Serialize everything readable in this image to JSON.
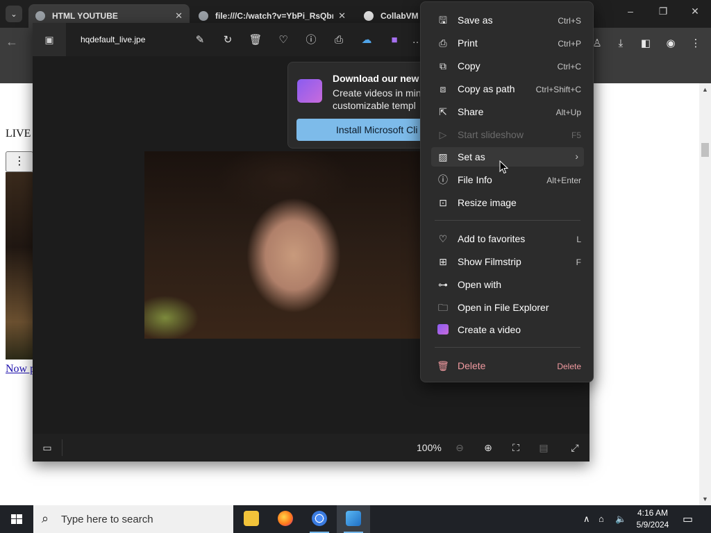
{
  "browser": {
    "tabs": [
      {
        "title": "HTML YOUTUBE",
        "active": true
      },
      {
        "title": "file:///C:/watch?v=YbPi_RsQbr",
        "active": false
      },
      {
        "title": "CollabVM",
        "active": false
      }
    ],
    "tab_close": "✕",
    "tab_list_icon": "⌄",
    "window_controls": [
      "–",
      "❐",
      "✕"
    ]
  },
  "webpage": {
    "live_text": "LIVE",
    "menu_glyph": "⋮",
    "link_text": "Now p"
  },
  "photos": {
    "filename": "hqdefault_live.jpe",
    "toolbar_icons": [
      "edit-image-icon",
      "rotate-icon",
      "delete-icon",
      "favorite-icon",
      "info-icon",
      "print-icon",
      "onedrive-icon",
      "clipchamp-icon",
      "more-icon"
    ],
    "promo": {
      "title": "Download our new v",
      "text": "Create videos in min customizable templ",
      "button": "Install Microsoft Cli"
    },
    "footer": {
      "zoom": "100%"
    }
  },
  "context_menu": {
    "items": [
      {
        "label": "Save as",
        "accel": "Ctrl+S",
        "icon": "save-as-icon"
      },
      {
        "label": "Print",
        "accel": "Ctrl+P",
        "icon": "print-icon"
      },
      {
        "label": "Copy",
        "accel": "Ctrl+C",
        "icon": "copy-icon"
      },
      {
        "label": "Copy as path",
        "accel": "Ctrl+Shift+C",
        "icon": "copy-path-icon"
      },
      {
        "label": "Share",
        "accel": "Alt+Up",
        "icon": "share-icon"
      },
      {
        "label": "Start slideshow",
        "accel": "F5",
        "icon": "slideshow-icon",
        "disabled": true
      },
      {
        "label": "Set as",
        "accel": "",
        "icon": "set-as-icon",
        "submenu": true
      },
      {
        "label": "File Info",
        "accel": "Alt+Enter",
        "icon": "info-icon"
      },
      {
        "label": "Resize image",
        "accel": "",
        "icon": "resize-icon"
      },
      {
        "label": "Add to favorites",
        "accel": "L",
        "icon": "heart-icon"
      },
      {
        "label": "Show Filmstrip",
        "accel": "F",
        "icon": "filmstrip-icon"
      },
      {
        "label": "Open with",
        "accel": "",
        "icon": "open-with-icon"
      },
      {
        "label": "Open in File Explorer",
        "accel": "",
        "icon": "folder-icon"
      },
      {
        "label": "Create a video",
        "accel": "",
        "icon": "clipchamp-icon"
      },
      {
        "label": "Delete",
        "accel": "Delete",
        "icon": "trash-icon",
        "danger": true
      }
    ]
  },
  "taskbar": {
    "search_placeholder": "Type here to search",
    "apps": [
      "file-explorer",
      "firefox",
      "chrome",
      "photos"
    ],
    "time": "4:16 AM",
    "date": "5/9/2024"
  }
}
